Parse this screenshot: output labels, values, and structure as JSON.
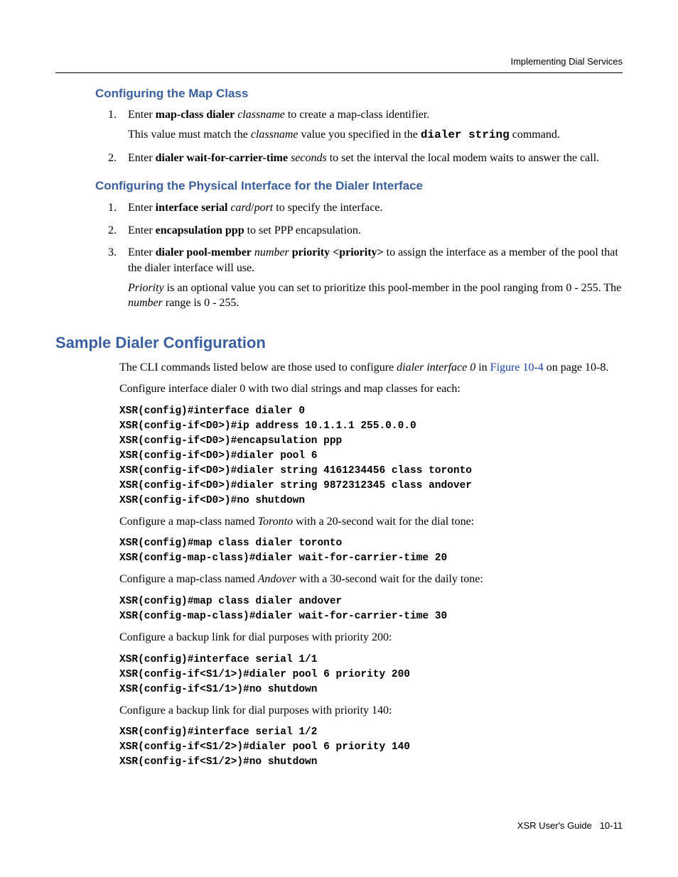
{
  "running_head": "Implementing Dial Services",
  "h_map": "Configuring the Map Class",
  "map_steps": {
    "s1": {
      "pre": "Enter ",
      "cmd": "map-class dialer",
      "mid": " ",
      "arg": "classname",
      "post": " to create a map-class identifier."
    },
    "s1_sub": {
      "a": "This value must match the ",
      "b": "classname",
      "c": " value you specified in the ",
      "d": "dialer string",
      "e": " command."
    },
    "s2": {
      "pre": "Enter ",
      "cmd": "dialer wait-for-carrier-time",
      "mid": " ",
      "arg": "seconds",
      "post": " to set the interval the local modem waits to answer the call."
    }
  },
  "h_phys": "Configuring the Physical Interface for the Dialer Interface",
  "phys_steps": {
    "s1": {
      "pre": "Enter ",
      "cmd": "interface serial",
      "mid": " ",
      "arg1": "card",
      "sep": "/",
      "arg2": "port",
      "post": " to specify the interface."
    },
    "s2": {
      "pre": "Enter ",
      "cmd": "encapsulation ppp",
      "post": " to set PPP encapsulation."
    },
    "s3": {
      "pre": "Enter ",
      "cmd1": "dialer pool-member",
      "mid1": " ",
      "arg1": "number",
      "mid2": " ",
      "cmd2": "priority <priority>",
      "post": " to assign the interface as a member of the pool that the dialer interface will use."
    },
    "s3_sub": {
      "a": "Priority",
      "b": " is an optional value you can set to prioritize this pool-member in the pool ranging from 0 - 255. The ",
      "c": "number",
      "d": " range is 0 - 255."
    }
  },
  "h_sample": "Sample Dialer Configuration",
  "sample_intro": {
    "a": "The CLI commands listed below are those used to configure ",
    "b": "dialer interface 0",
    "c": " in ",
    "d": "Figure 10-4",
    "e": " on page 10-8."
  },
  "sample_p2": "Configure interface dialer 0 with two dial strings and map classes for each:",
  "cli1": "XSR(config)#interface dialer 0\nXSR(config-if<D0>)#ip address 10.1.1.1 255.0.0.0\nXSR(config-if<D0>)#encapsulation ppp\nXSR(config-if<D0>)#dialer pool 6\nXSR(config-if<D0>)#dialer string 4161234456 class toronto\nXSR(config-if<D0>)#dialer string 9872312345 class andover\nXSR(config-if<D0>)#no shutdown",
  "p_toronto": {
    "a": "Configure a map-class named ",
    "b": "Toronto",
    "c": " with a 20-second wait for the dial tone:"
  },
  "cli2": "XSR(config)#map class dialer toronto\nXSR(config-map-class)#dialer wait-for-carrier-time 20",
  "p_andover": {
    "a": "Configure a map-class named ",
    "b": "Andover",
    "c": " with a 30-second wait for the daily tone:"
  },
  "cli3": "XSR(config)#map class dialer andover\nXSR(config-map-class)#dialer wait-for-carrier-time 30",
  "p_backup1": "Configure a backup link for dial purposes with priority 200:",
  "cli4": "XSR(config)#interface serial 1/1\nXSR(config-if<S1/1>)#dialer pool 6 priority 200\nXSR(config-if<S1/1>)#no shutdown",
  "p_backup2": "Configure a backup link for dial purposes with priority 140:",
  "cli5": "XSR(config)#interface serial 1/2\nXSR(config-if<S1/2>)#dialer pool 6 priority 140\nXSR(config-if<S1/2>)#no shutdown",
  "footer": {
    "guide": "XSR User's Guide",
    "page": "10-11"
  }
}
